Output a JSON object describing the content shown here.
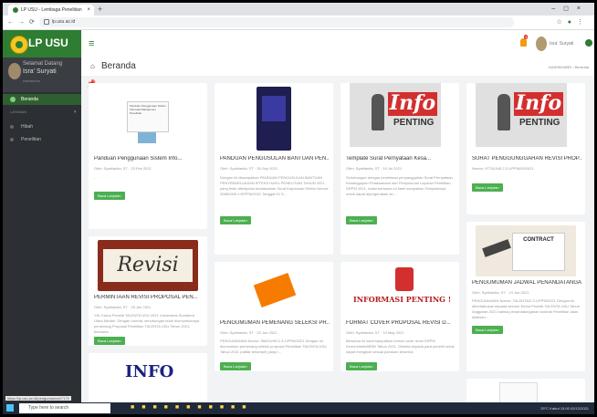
{
  "browser": {
    "tab_title": "LP USU - Lembaga Penelitian",
    "url": "lp.usu.ac.id",
    "status_url": "https://lp.usu.ac.id/pengumuman/7170"
  },
  "brand": {
    "name": "LP USU"
  },
  "user": {
    "welcome": "Selamat Datang",
    "name": "Isra' Suryati",
    "role": "researcher",
    "top_name": "Isra' Suryati"
  },
  "sidebar": {
    "items": [
      {
        "label": "Beranda"
      }
    ],
    "group_label": "LAYANAN",
    "sub_items": [
      "Hibah",
      "Penelitian"
    ]
  },
  "header": {
    "title": "Beranda",
    "breadcrumb": "DASHBOARD › Beranda"
  },
  "cards": [
    {
      "title": "Panduan Penggunaan Sistem Info...",
      "meta": "Oleh: Syafrianita, ST · 23 Feb 2021",
      "excerpt": "-",
      "button": "Baca Lanjutan",
      "thumb": "doc"
    },
    {
      "title": "PANDUAN PENGUSULAN BANTUAN PEN...",
      "meta": "Oleh: Syafrianita, ST · 30 Sep 2021",
      "excerpt": "Dengan ini disampaikan PANDUAN PENGUSULAN BANTUAN PENYEBARLUASAN IPTEKS HASIL PENELITIAN TAHUN 2021 yang telah ditetapkan berdasarkan Surat Keputusan Rektor Nomor: 3068/UN5.1.R/PPM/2021 Tanggal 02 S...",
      "button": "Baca Lanjutan",
      "thumb": "book"
    },
    {
      "title": "Template Surat Pernyataan Kesa...",
      "meta": "Oleh: Syafrianita, ST · 19 Jul 2021",
      "excerpt": "Sehubungan dengan pemintaan penyanggahan Surat Pernyataan Kesanggupan Pelaksanaan dan Penyusunan Laporan Penelitian DRPM 2021, maka bersama ini kami sampaikan Templatenya untuk dapat dipergunakan se...",
      "button": "Baca Lanjutan",
      "thumb": "info"
    },
    {
      "title": "SURAT PENGGUNGGAHAN REVISI PROP...",
      "meta": "Nomor: 9770/UN5.2.3.1/PPM/05/2021",
      "excerpt": "",
      "button": "Baca Lanjutan",
      "thumb": "info"
    },
    {
      "title": "PERMINTAAN REVISI PROPOSAL PEN...",
      "meta": "Oleh: Syafrianita, ST · 28 Jun 2021",
      "excerpt": "Yth. Ketua Peneliti TALENTA USU 2021 Universitas Sumatera Utara Medan. Dengan hormat, sehubungan telah diumumkannya pemenang Proposal Penelitian TALENTA USU Tahun 2021, bersama ...",
      "button": "Baca Lanjutan",
      "thumb": "revisi"
    },
    {
      "title": "PENGUMUMAN PEMENANG SELEKSI PR...",
      "meta": "Oleh: Syafrianita, ST · 20 Jun 2021",
      "excerpt": "PENGUMUMAN Nomor: 5660/UN5.2.3.1/PPM/2021 Dengan ini diumumkan pemenang seleksi proposal Penelitian TALENTA USU Tahun 2021 (daftar terlampir) yang t...",
      "button": "Baca Lanjutan",
      "thumb": "folder"
    },
    {
      "title": "FORMAT COVER PROPOSAL REVISI D...",
      "meta": "Oleh: Syafrianita, ST · 10 May 2021",
      "excerpt": "Bersama ini kami sampaikan format cover revisi DRPM Kemenristek/BRIN Tahun 2021. Diminta kepada para peneliti untuk dapat mengikuti sesuai panduan tersebut.",
      "button": "Baca Lanjutan",
      "thumb": "informasi"
    },
    {
      "title": "PENGUMUMAN JADWAL PENANDATANGA...",
      "meta": "Oleh: Syafrianita, ST · 24 Jun 2021",
      "excerpt": "PENGUMUMAN Nomor: TALENTA/2.3.1/PPM/2021 Dengan ini diberitahukan kepada seluruh Ketua Peneliti TALENTA USU Tahun Anggaran 2021 bahwa penandatanganan kontrak Penelitian akan dilaksan...",
      "button": "Baca Lanjutan",
      "thumb": "contract"
    }
  ],
  "thumb_text": {
    "info": "Info",
    "penting": "PENTING",
    "revisi": "Revisi",
    "informasi": "INFORMASI PENTING !!",
    "contract": "CONTRACT",
    "bottom_info": "INFO",
    "doc_title": "Panduan Penggunaan Sistem Informasi Manajemen Penelitian"
  },
  "taskbar": {
    "search_placeholder": "Type here to search",
    "weather": "29°C Kabut",
    "time": "13:00",
    "date": "02/12/2021"
  },
  "colors": {
    "brand_green": "#2e7d32",
    "button_green": "#4caf50",
    "sidebar_dark": "#2c2f33",
    "info_red": "#d32f2f"
  }
}
